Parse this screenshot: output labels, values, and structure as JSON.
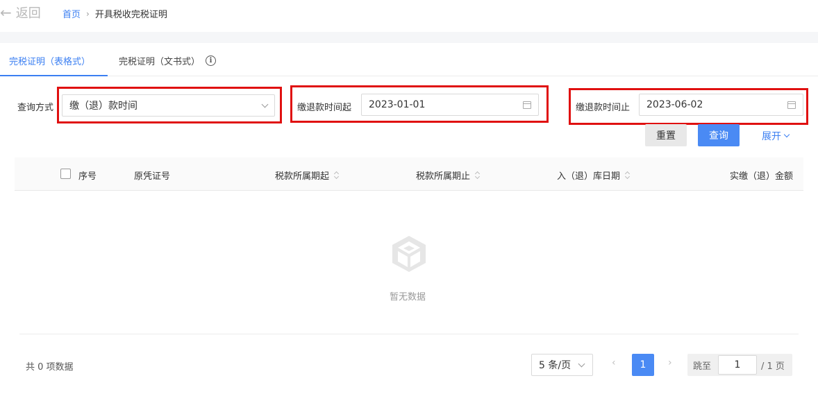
{
  "header": {
    "back_arrow": "←",
    "back_label": "返回",
    "breadcrumb_home": "首页",
    "breadcrumb_sep": "›",
    "breadcrumb_current": "开具税收完税证明"
  },
  "tabs": [
    {
      "label": "完税证明（表格式）",
      "active": true
    },
    {
      "label": "完税证明（文书式）",
      "active": false
    }
  ],
  "info_icon_glyph": "i",
  "form": {
    "query_method_label": "查询方式",
    "query_method_value": "缴（退）款时间",
    "start_label": "缴退款时间起",
    "start_value": "2023-01-01",
    "end_label": "缴退款时间止",
    "end_value": "2023-06-02",
    "reset_label": "重置",
    "query_label": "查询",
    "expand_label": "展开"
  },
  "table": {
    "columns": [
      "序号",
      "原凭证号",
      "税款所属期起",
      "税款所属期止",
      "入（退）库日期",
      "实缴（退）金额"
    ],
    "empty_text": "暂无数据"
  },
  "pagination": {
    "total_text": "共 0 项数据",
    "page_size": "5 条/页",
    "prev": "‹",
    "next": "›",
    "current_page": "1",
    "jump_label": "跳至",
    "jump_value": "1",
    "total_pages": "/ 1 页"
  },
  "colors": {
    "accent": "#3b7ff2",
    "primary_button": "#4a8af4",
    "highlight_border": "#e01010"
  }
}
